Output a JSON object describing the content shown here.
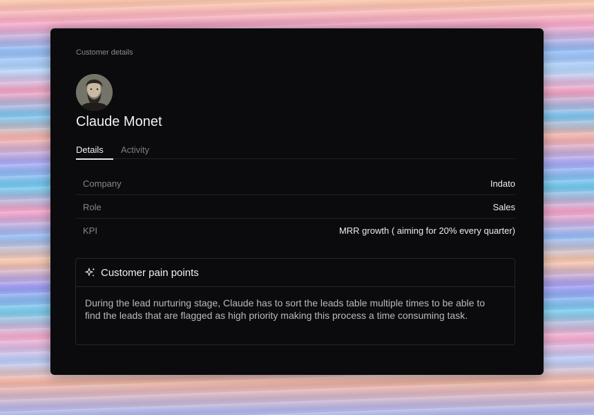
{
  "page": {
    "breadcrumb": "Customer details"
  },
  "customer": {
    "name": "Claude Monet",
    "avatar_icon": "portrait-avatar"
  },
  "tabs": [
    {
      "label": "Details",
      "active": true
    },
    {
      "label": "Activity",
      "active": false
    }
  ],
  "details": [
    {
      "label": "Company",
      "value": "Indato"
    },
    {
      "label": "Role",
      "value": "Sales"
    },
    {
      "label": "KPI",
      "value": "MRR growth ( aiming for 20% every quarter)"
    }
  ],
  "pain_points": {
    "icon": "sparkles-icon",
    "title": "Customer pain points",
    "body": "During the lead nurturing stage, Claude has to sort the leads table multiple times to be able to find the leads that are flagged as high priority making this process a time consuming task."
  },
  "colors": {
    "card_bg": "#0b0b0d",
    "text_primary": "#f2f2f4",
    "text_muted": "#86868d",
    "divider": "#24242a"
  }
}
